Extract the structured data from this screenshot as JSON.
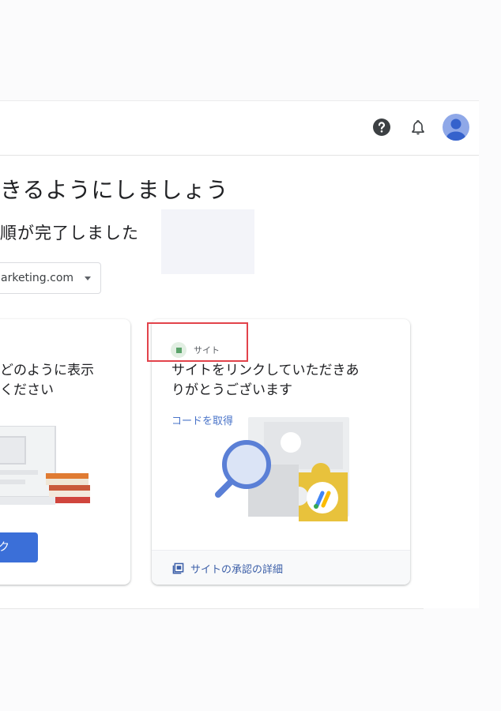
{
  "header": {
    "help_icon": "help-icon",
    "notifications_icon": "bell-icon",
    "avatar_icon": "account-icon"
  },
  "main": {
    "title": "きるようにしましょう",
    "subtitle": "順が完了しました",
    "site_select": {
      "value": "arketing.com"
    }
  },
  "cards": {
    "left": {
      "heading_line1": "どのように表示",
      "heading_line2": "ください",
      "button_label": "ック"
    },
    "right": {
      "tag_label": "サイト",
      "heading_line1": "サイトをリンクしていただきあ",
      "heading_line2": "りがとうございます",
      "code_link": "コードを取得",
      "footer_link": "サイトの承認の詳細"
    }
  },
  "colors": {
    "accent": "#3b6fd8",
    "link": "#4a74c9",
    "highlight": "#e2434b",
    "ad_yellow": "#e8c23c"
  }
}
